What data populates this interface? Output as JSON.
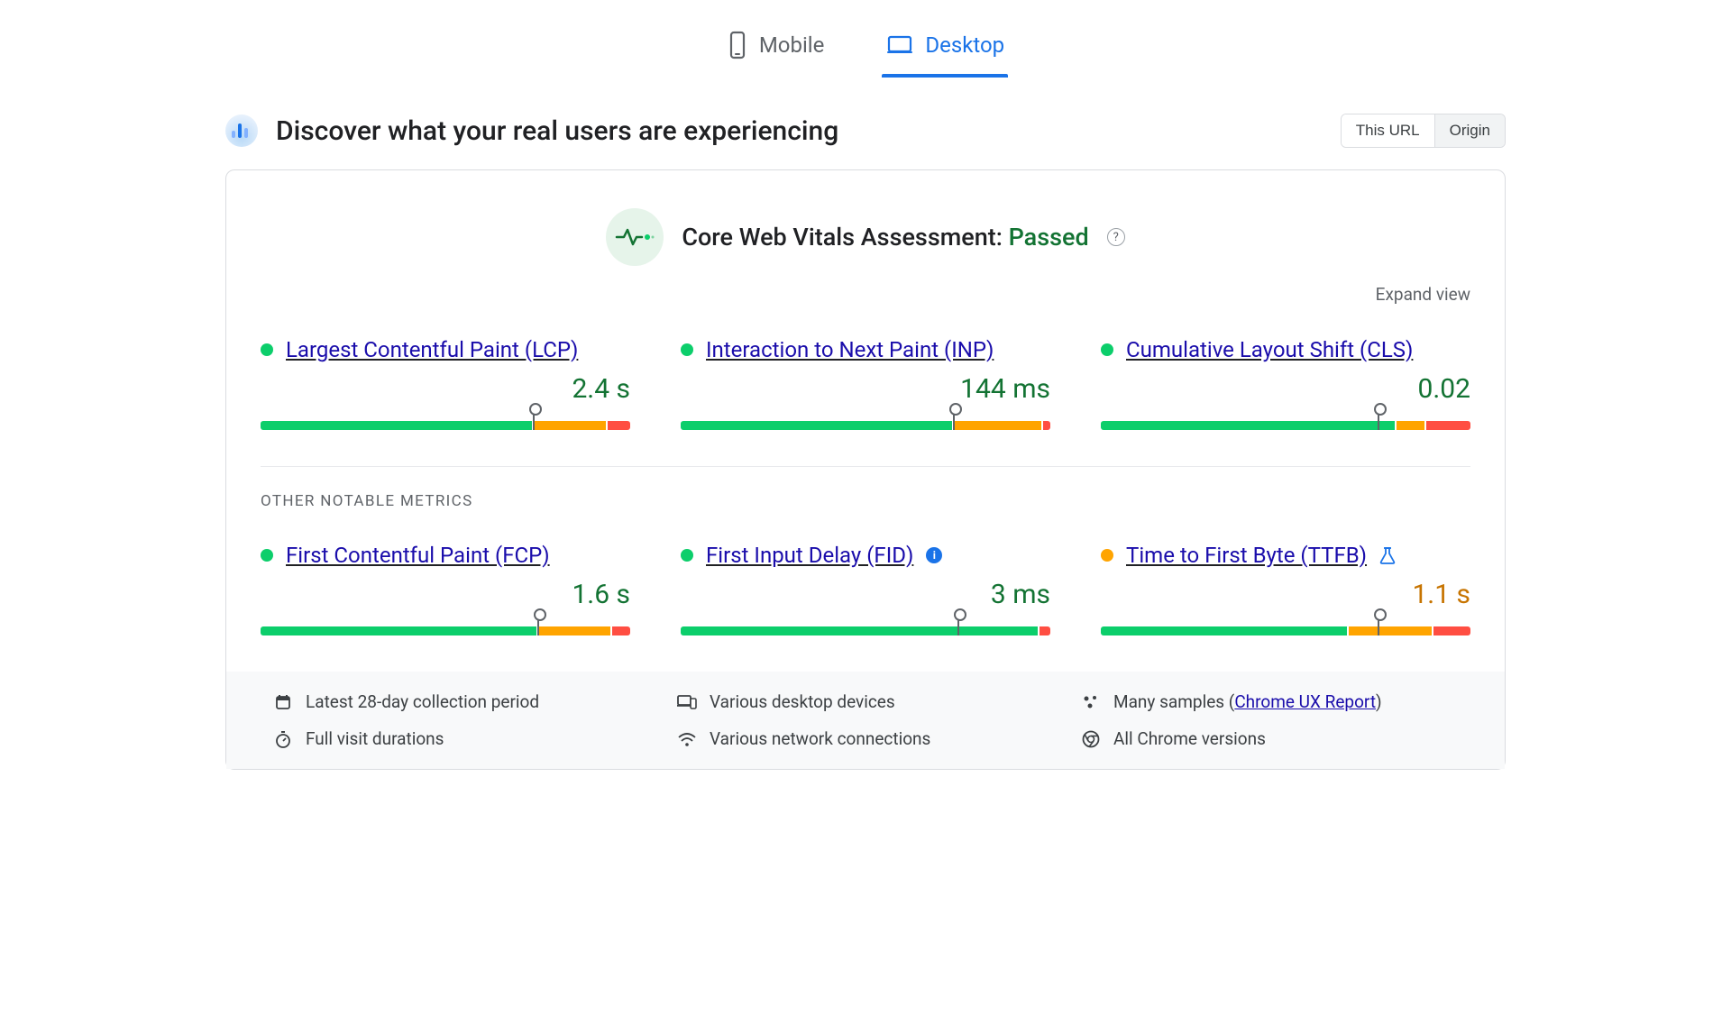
{
  "tabs": {
    "mobile": "Mobile",
    "desktop": "Desktop"
  },
  "header": {
    "title": "Discover what your real users are experiencing",
    "toggle_this_url": "This URL",
    "toggle_origin": "Origin"
  },
  "assessment": {
    "label": "Core Web Vitals Assessment: ",
    "status": "Passed"
  },
  "expand_label": "Expand view",
  "metrics": [
    {
      "name": "Largest Contentful Paint (LCP)",
      "value": "2.4 s",
      "status": "green",
      "bar": {
        "green": 74,
        "orange": 20,
        "red": 6,
        "marker": 74
      }
    },
    {
      "name": "Interaction to Next Paint (INP)",
      "value": "144 ms",
      "status": "green",
      "bar": {
        "green": 74,
        "orange": 24,
        "red": 2,
        "marker": 74
      }
    },
    {
      "name": "Cumulative Layout Shift (CLS)",
      "value": "0.02",
      "status": "green",
      "bar": {
        "green": 80,
        "orange": 8,
        "red": 12,
        "marker": 75
      }
    }
  ],
  "other_label": "OTHER NOTABLE METRICS",
  "other_metrics": [
    {
      "name": "First Contentful Paint (FCP)",
      "value": "1.6 s",
      "status": "green",
      "bar": {
        "green": 75,
        "orange": 20,
        "red": 5,
        "marker": 75
      },
      "badge": null
    },
    {
      "name": "First Input Delay (FID)",
      "value": "3 ms",
      "status": "green",
      "bar": {
        "green": 97,
        "orange": 0,
        "red": 3,
        "marker": 75
      },
      "badge": "info"
    },
    {
      "name": "Time to First Byte (TTFB)",
      "value": "1.1 s",
      "status": "orange",
      "bar": {
        "green": 67,
        "orange": 23,
        "red": 10,
        "marker": 75
      },
      "badge": "flask"
    }
  ],
  "info": {
    "period": "Latest 28-day collection period",
    "devices": "Various desktop devices",
    "samples_prefix": "Many samples (",
    "samples_link": "Chrome UX Report",
    "samples_suffix": ")",
    "durations": "Full visit durations",
    "network": "Various network connections",
    "chrome": "All Chrome versions"
  }
}
